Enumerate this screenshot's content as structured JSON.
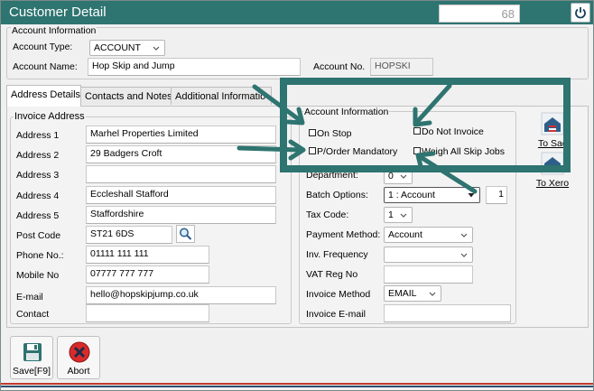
{
  "window": {
    "title": "Customer Detail",
    "record_number": "68"
  },
  "account_info": {
    "legend": "Account Information",
    "account_type_label": "Account Type:",
    "account_type_value": "ACCOUNT",
    "account_name_label": "Account Name:",
    "account_name_value": "Hop Skip and Jump",
    "account_no_label": "Account No.",
    "account_no_value": "HOPSKI"
  },
  "tabs": [
    {
      "label": "Address Details",
      "active": true
    },
    {
      "label": "Contacts and Notes",
      "active": false
    },
    {
      "label": "Additional Informatio",
      "active": false
    }
  ],
  "invoice_address": {
    "legend": "Invoice Address",
    "fields": [
      {
        "label": "Address 1",
        "value": "Marhel Properties Limited"
      },
      {
        "label": "Address 2",
        "value": "29 Badgers Croft"
      },
      {
        "label": "Address 3",
        "value": ""
      },
      {
        "label": "Address 4",
        "value": "Eccleshall Stafford"
      },
      {
        "label": "Address 5",
        "value": "Staffordshire"
      },
      {
        "label": "Post Code",
        "value": "ST21 6DS"
      },
      {
        "label": "Phone No.:",
        "value": "01111 111 111"
      },
      {
        "label": "Mobile No",
        "value": "07777 777 777"
      },
      {
        "label": "E-mail",
        "value": "hello@hopskipjump.co.uk"
      },
      {
        "label": "Contact",
        "value": ""
      }
    ]
  },
  "right_panel": {
    "legend": "Account Information",
    "checkboxes": [
      {
        "label": "On Stop",
        "checked": false
      },
      {
        "label": "Do Not Invoice",
        "checked": false
      },
      {
        "label": "P/Order Mandatory",
        "checked": false
      },
      {
        "label": "Weigh All Skip Jobs",
        "checked": false
      }
    ],
    "department_label": "Department:",
    "department_value": "0",
    "batch_label": "Batch Options:",
    "batch_value": "1 : Account",
    "batch_number": "1",
    "tax_label": "Tax Code:",
    "tax_value": "1",
    "payment_label": "Payment Method:",
    "payment_value": "Account",
    "frequency_label": "Inv. Frequency",
    "frequency_value": "",
    "vat_label": "VAT Reg No",
    "vat_value": "",
    "inv_method_label": "Invoice Method",
    "inv_method_value": "EMAIL",
    "inv_email_label": "Invoice E-mail",
    "inv_email_value": ""
  },
  "side_buttons": {
    "to_sage": "To Sac",
    "to_xero": "To Xero"
  },
  "toolbar": {
    "save_label": "Save[F9]",
    "abort_label": "Abort"
  },
  "colors": {
    "title_bar": "#2e7470",
    "highlight_box": "#2e7470",
    "abort_red": "#d92b2b",
    "save_teal": "#2e7470",
    "footer_red": "#c0392b"
  }
}
